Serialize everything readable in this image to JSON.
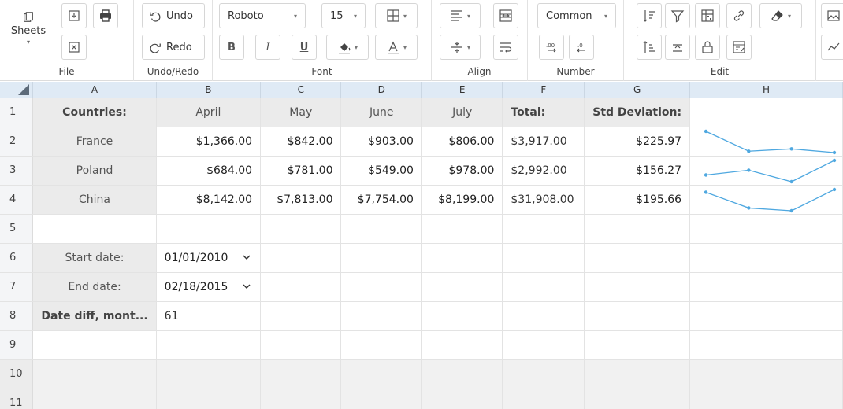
{
  "ribbon": {
    "file": {
      "label": "File",
      "sheets_label": "Sheets"
    },
    "undo_redo": {
      "label": "Undo/Redo",
      "undo": "Undo",
      "redo": "Redo"
    },
    "font": {
      "label": "Font",
      "family": "Roboto",
      "size": "15",
      "bold": "B",
      "italic": "I",
      "underline": "U"
    },
    "align": {
      "label": "Align"
    },
    "number": {
      "label": "Number",
      "format": "Common"
    },
    "edit": {
      "label": "Edit"
    }
  },
  "columns": [
    "A",
    "B",
    "C",
    "D",
    "E",
    "F",
    "G",
    "H"
  ],
  "rows": [
    "1",
    "2",
    "3",
    "4",
    "5",
    "6",
    "7",
    "8",
    "9",
    "10",
    "11"
  ],
  "table": {
    "header": {
      "a": "Countries:",
      "b": "April",
      "c": "May",
      "d": "June",
      "e": "July",
      "f": "Total:",
      "g": "Std Deviation:"
    },
    "data": [
      {
        "country": "France",
        "april": "$1,366.00",
        "may": "$842.00",
        "june": "$903.00",
        "july": "$806.00",
        "total": "$3,917.00",
        "std": "$225.97",
        "spark": [
          1366,
          842,
          903,
          806
        ]
      },
      {
        "country": "Poland",
        "april": "$684.00",
        "may": "$781.00",
        "june": "$549.00",
        "july": "$978.00",
        "total": "$2,992.00",
        "std": "$156.27",
        "spark": [
          684,
          781,
          549,
          978
        ]
      },
      {
        "country": "China",
        "april": "$8,142.00",
        "may": "$7,813.00",
        "june": "$7,754.00",
        "july": "$8,199.00",
        "total": "$31,908.00",
        "std": "$195.66",
        "spark": [
          8142,
          7813,
          7754,
          8199
        ]
      }
    ],
    "start_label": "Start date:",
    "start_value": "01/01/2010",
    "end_label": "End date:",
    "end_value": "02/18/2015",
    "diff_label": "Date diff, mont...",
    "diff_value": "61"
  },
  "colors": {
    "spark": "#4fa8e0",
    "header_bg": "#dfeaf5",
    "label_bg": "#ebebeb"
  }
}
